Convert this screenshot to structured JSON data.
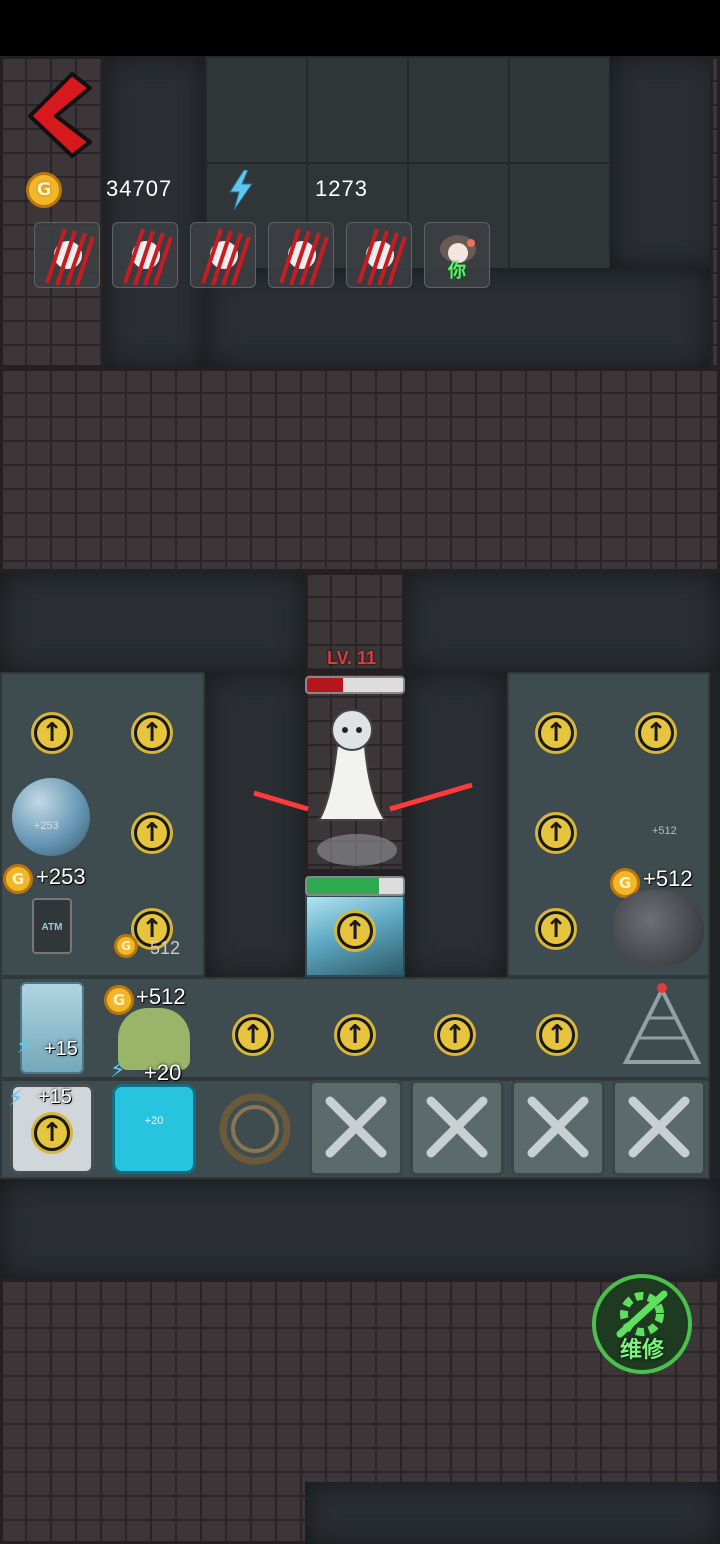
{
  "hud": {
    "gold_value": "34707",
    "energy_value": "1273",
    "gold_icon_letter": "G"
  },
  "party": {
    "slots": [
      "claw",
      "claw",
      "claw",
      "claw",
      "claw",
      "you"
    ],
    "you_label": "你"
  },
  "enemy": {
    "level_label": "LV. 11",
    "hp_fraction": 0.38
  },
  "door": {
    "hp_fraction": 0.75
  },
  "resources": {
    "orb_small_label": "+253",
    "gold_253": "+253",
    "gold_512_right": "+512",
    "gold_512_right_small": "+512",
    "gold_512_mid": "+512",
    "gold_512_small": "512",
    "energy_15_a": "+15",
    "energy_15_b": "+15",
    "energy_20": "+20",
    "energy_20_small": "+20",
    "atm_label": "ATM"
  },
  "repair": {
    "label": "维修"
  },
  "colors": {
    "accent_red": "#d7181c",
    "gold": "#f2b629",
    "energy": "#5ec6f2",
    "repair_green": "#4cc04d"
  },
  "icons": {
    "back": "back-arrow-icon",
    "upgrade": "upgrade-arrow-icon",
    "tools": "wrench-screwdriver-icon",
    "repair": "gear-wrench-icon"
  }
}
